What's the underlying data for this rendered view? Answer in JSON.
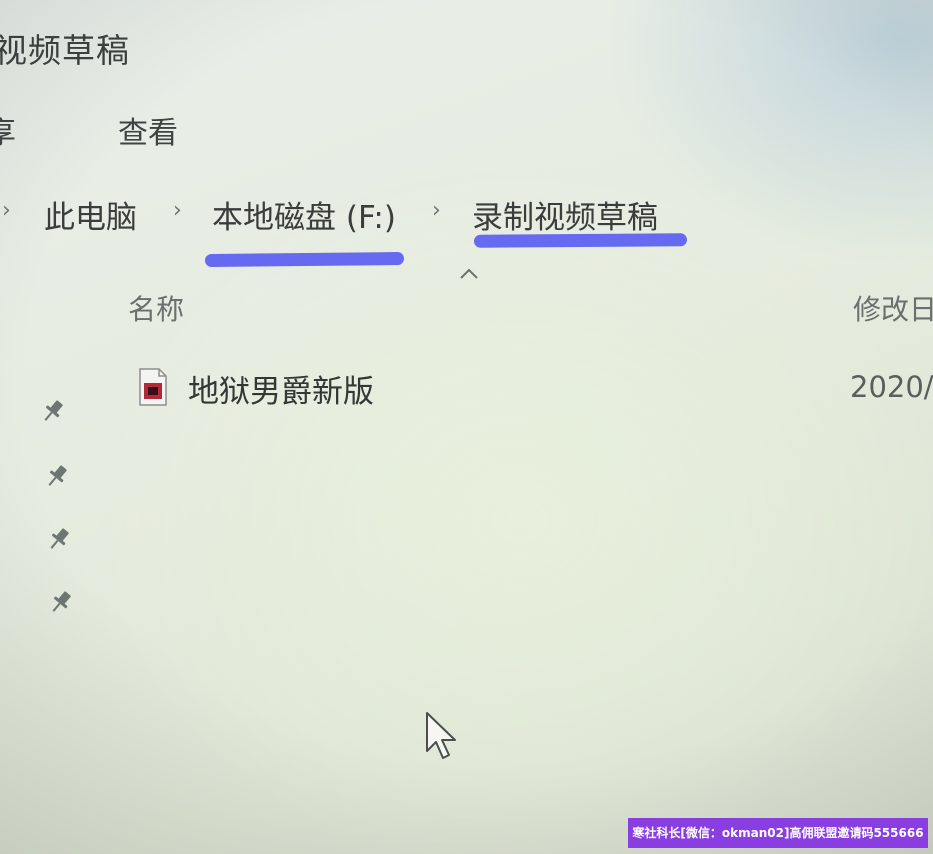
{
  "window": {
    "title": "视频草稿"
  },
  "ribbon": {
    "share_label": "享",
    "view_label": "查看"
  },
  "breadcrumb": {
    "items": [
      {
        "label": "此电脑"
      },
      {
        "label": "本地磁盘 (F:)"
      },
      {
        "label": "录制视频草稿"
      }
    ],
    "highlight_color": "#5b5ef2"
  },
  "columns": {
    "name": "名称",
    "modified": "修改日"
  },
  "files": [
    {
      "name": "地狱男爵新版",
      "modified": "2020/",
      "icon": "video-file-icon"
    }
  ],
  "quick_access": {
    "pins": [
      "pin-icon",
      "pin-icon",
      "pin-icon",
      "pin-icon"
    ]
  },
  "watermark": {
    "text": "寒社科长[微信：okman02]高佣联盟邀请码555666",
    "color": "#8a3de0"
  }
}
